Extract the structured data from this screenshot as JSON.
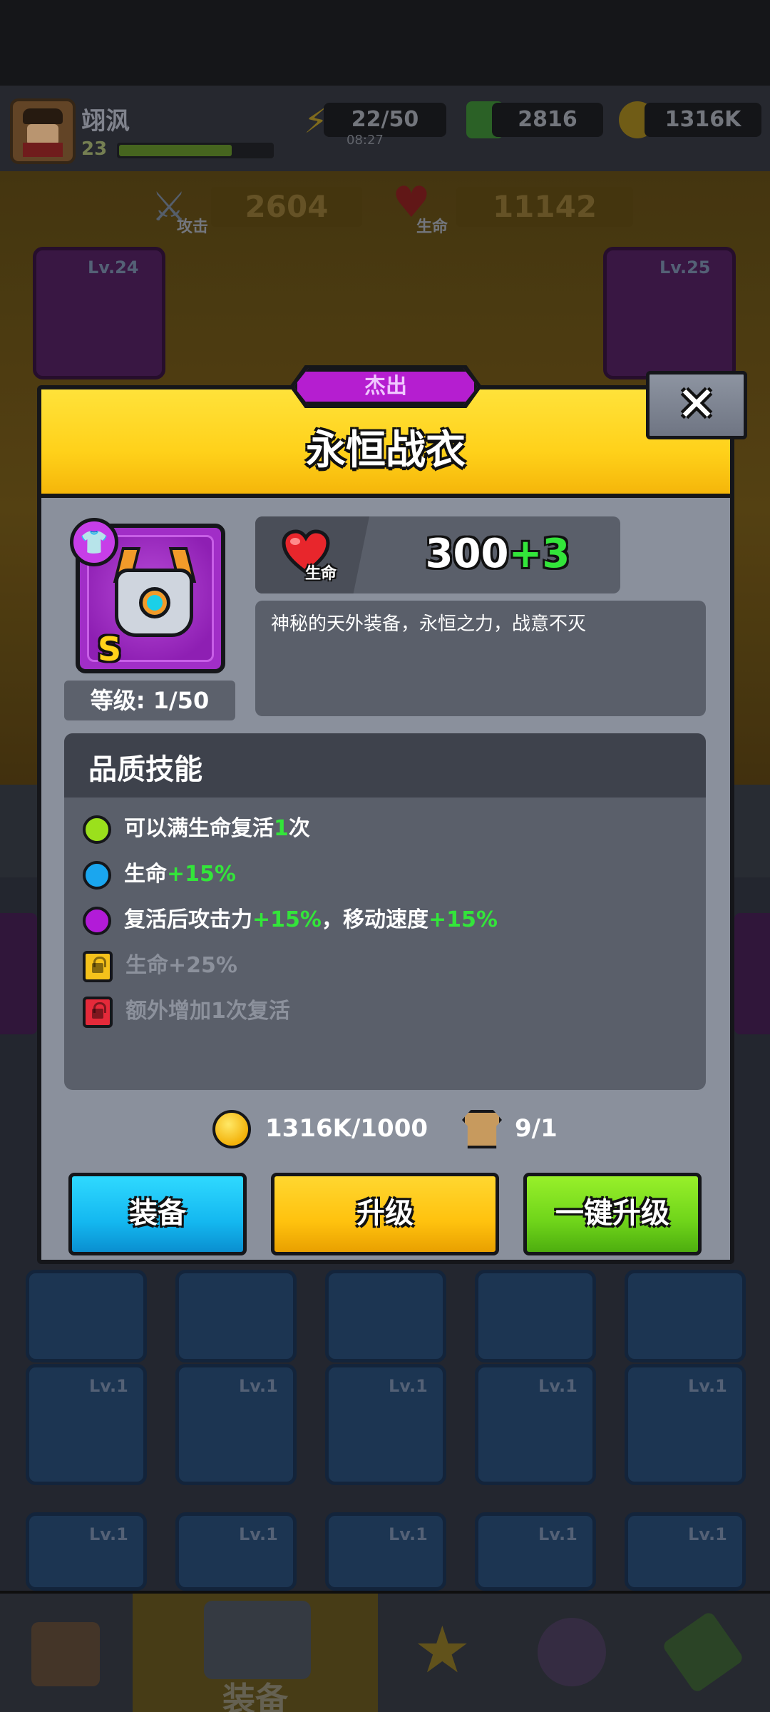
{
  "player": {
    "name": "翊沨",
    "level": "23",
    "xp_fraction": 0.74
  },
  "resources": {
    "energy": "22/50",
    "energy_timer": "08:27",
    "gems": "2816",
    "coins": "1316K"
  },
  "stats_bar": {
    "attack_label": "攻击",
    "attack_value": "2604",
    "hp_label": "生命",
    "hp_value": "11142"
  },
  "background_slots": {
    "left_level": "Lv.24",
    "right_level": "Lv.25",
    "left_count": "2",
    "grid_level": "Lv.1"
  },
  "modal": {
    "rarity": "杰出",
    "title": "永恒战衣",
    "close_symbol": "✕",
    "grade": "S",
    "level_text": "等级: 1/50",
    "stat_label": "生命",
    "stat_base": "300",
    "stat_bonus": "+3",
    "description": "神秘的天外装备，永恒之力，战意不灭",
    "skills_title": "品质技能",
    "skills": [
      {
        "parts": [
          [
            "可以满生命复活",
            ""
          ],
          [
            "1",
            "green"
          ],
          [
            "次",
            ""
          ]
        ],
        "color": "#9be01c",
        "kind": "dot",
        "locked": false
      },
      {
        "parts": [
          [
            "生命",
            ""
          ],
          [
            "+15%",
            "green"
          ]
        ],
        "color": "#1aa6ef",
        "kind": "dot",
        "locked": false
      },
      {
        "parts": [
          [
            "复活后攻击力",
            ""
          ],
          [
            "+15%",
            "green"
          ],
          [
            "，移动速度",
            ""
          ],
          [
            "+15%",
            "green"
          ]
        ],
        "color": "#b21bd8",
        "kind": "dot",
        "locked": false
      },
      {
        "parts": [
          [
            "生命+25%",
            ""
          ]
        ],
        "color": "#f5c21b",
        "kind": "lock",
        "locked": true
      },
      {
        "parts": [
          [
            "额外增加1次复活",
            ""
          ]
        ],
        "color": "#e52a3a",
        "kind": "lock",
        "locked": true
      }
    ],
    "cost_coins": "1316K/1000",
    "cost_items": "9/1",
    "buttons": {
      "equip": "装备",
      "upgrade": "升级",
      "upgrade_all": "一键升级"
    }
  },
  "nav": {
    "active_label": "装备"
  },
  "colors": {
    "accent_yellow": "#ffd11a",
    "rarity_purple": "#b51ed0",
    "bonus_green": "#33e53a",
    "button_blue": "#14b8f0",
    "button_yellow": "#ffc20e",
    "button_green": "#6fd41a"
  },
  "icons": {
    "close": "close-icon",
    "heart": "heart-icon",
    "coin": "coin-icon",
    "shirt": "shirt-icon",
    "slot": "chestplate-slot-icon"
  }
}
